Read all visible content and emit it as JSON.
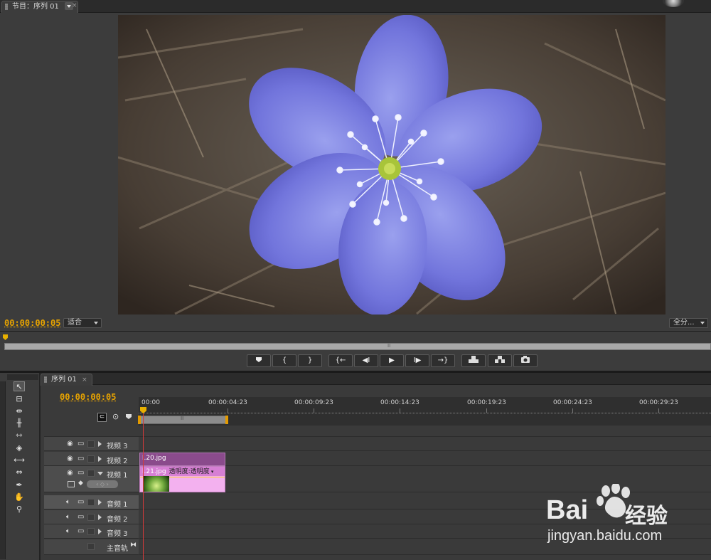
{
  "program_monitor": {
    "tab_label": "节目：序列 01",
    "timecode": "00:00:00:05",
    "fit_label": "适合",
    "quality_label": "全分...",
    "center_marker": "II"
  },
  "transport": {
    "marker_icon": "marker-icon",
    "in_label": "{",
    "out_label": "}",
    "goto_in_label": "{←",
    "step_back_label": "◀I",
    "play_label": "▶",
    "step_fwd_label": "I▶",
    "goto_out_label": "→}",
    "lift_icon": "lift-icon",
    "extract_icon": "extract-icon",
    "export_frame_icon": "camera-icon"
  },
  "timeline": {
    "tab_label": "序列 01",
    "timecode": "00:00:00:05",
    "ruler_labels": [
      "00:00",
      "00:00:04:23",
      "00:00:09:23",
      "00:00:14:23",
      "00:00:19:23",
      "00:00:24:23",
      "00:00:29:23"
    ],
    "work_area_marker": "II",
    "tracks": [
      {
        "name": "视频 3",
        "kind": "video"
      },
      {
        "name": "视频 2",
        "kind": "video"
      },
      {
        "name": "视频 1",
        "kind": "video"
      },
      {
        "name": "音频 1",
        "kind": "audio"
      },
      {
        "name": "音频 2",
        "kind": "audio"
      },
      {
        "name": "音频 3",
        "kind": "audio"
      },
      {
        "name": "主音轨",
        "kind": "master"
      }
    ],
    "clip_v2": "l.20.jpg",
    "clip_v1": "l.21.jpg",
    "clip_v1_effect": "透明度:透明度"
  },
  "tools": [
    "selection-tool",
    "track-select-tool",
    "ripple-edit-tool",
    "rolling-edit-tool",
    "rate-stretch-tool",
    "razor-tool",
    "slip-tool",
    "slide-tool",
    "pen-tool",
    "hand-tool",
    "zoom-tool"
  ],
  "watermark": {
    "brand": "Bai",
    "brand_cn": "经验",
    "url": "jingyan.baidu.com"
  },
  "colors": {
    "timecode": "#e8a400",
    "playhead": "#d43a3a",
    "clip_purple": "#8a4b8c",
    "clip_pink": "#f3b1ef"
  }
}
